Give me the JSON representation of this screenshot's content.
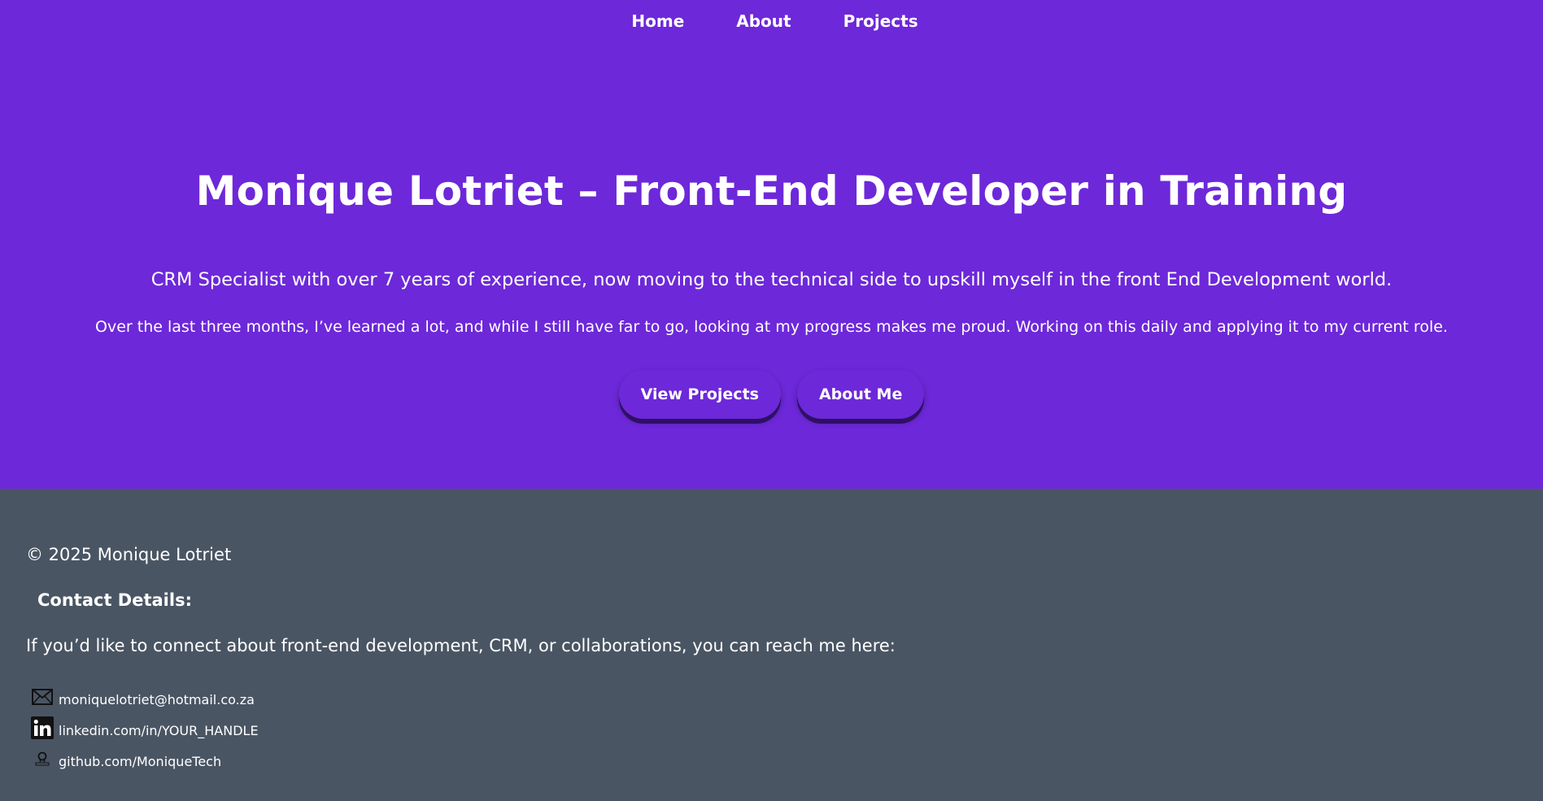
{
  "nav": {
    "items": [
      {
        "label": "Home"
      },
      {
        "label": "About"
      },
      {
        "label": "Projects"
      }
    ]
  },
  "hero": {
    "title": "Monique Lotriet – Front-End Developer in Training",
    "subtitle": "CRM Specialist with over 7 years of experience, now moving to the technical side to upskill myself in the front End Development world.",
    "description": "Over the last three months, I’ve learned a lot, and while I still have far to go, looking at my progress makes me proud. Working on this daily and applying it to my current role.",
    "buttons": {
      "view_projects": "View Projects",
      "about_me": "About Me"
    }
  },
  "footer": {
    "copyright": "© 2025 Monique Lotriet",
    "contact_heading": "Contact Details:",
    "contact_intro": "If you’d like to connect about front-end development, CRM, or collaborations, you can reach me here:",
    "contacts": [
      {
        "icon": "mail-icon",
        "text": "moniquelotriet@hotmail.co.za"
      },
      {
        "icon": "linkedin-icon",
        "text": "linkedin.com/in/YOUR_HANDLE"
      },
      {
        "icon": "github-icon",
        "text": "github.com/MoniqueTech"
      }
    ]
  },
  "colors": {
    "hero_bg": "#6d28d9",
    "footer_bg": "#4a5563",
    "text": "#ffffff"
  }
}
